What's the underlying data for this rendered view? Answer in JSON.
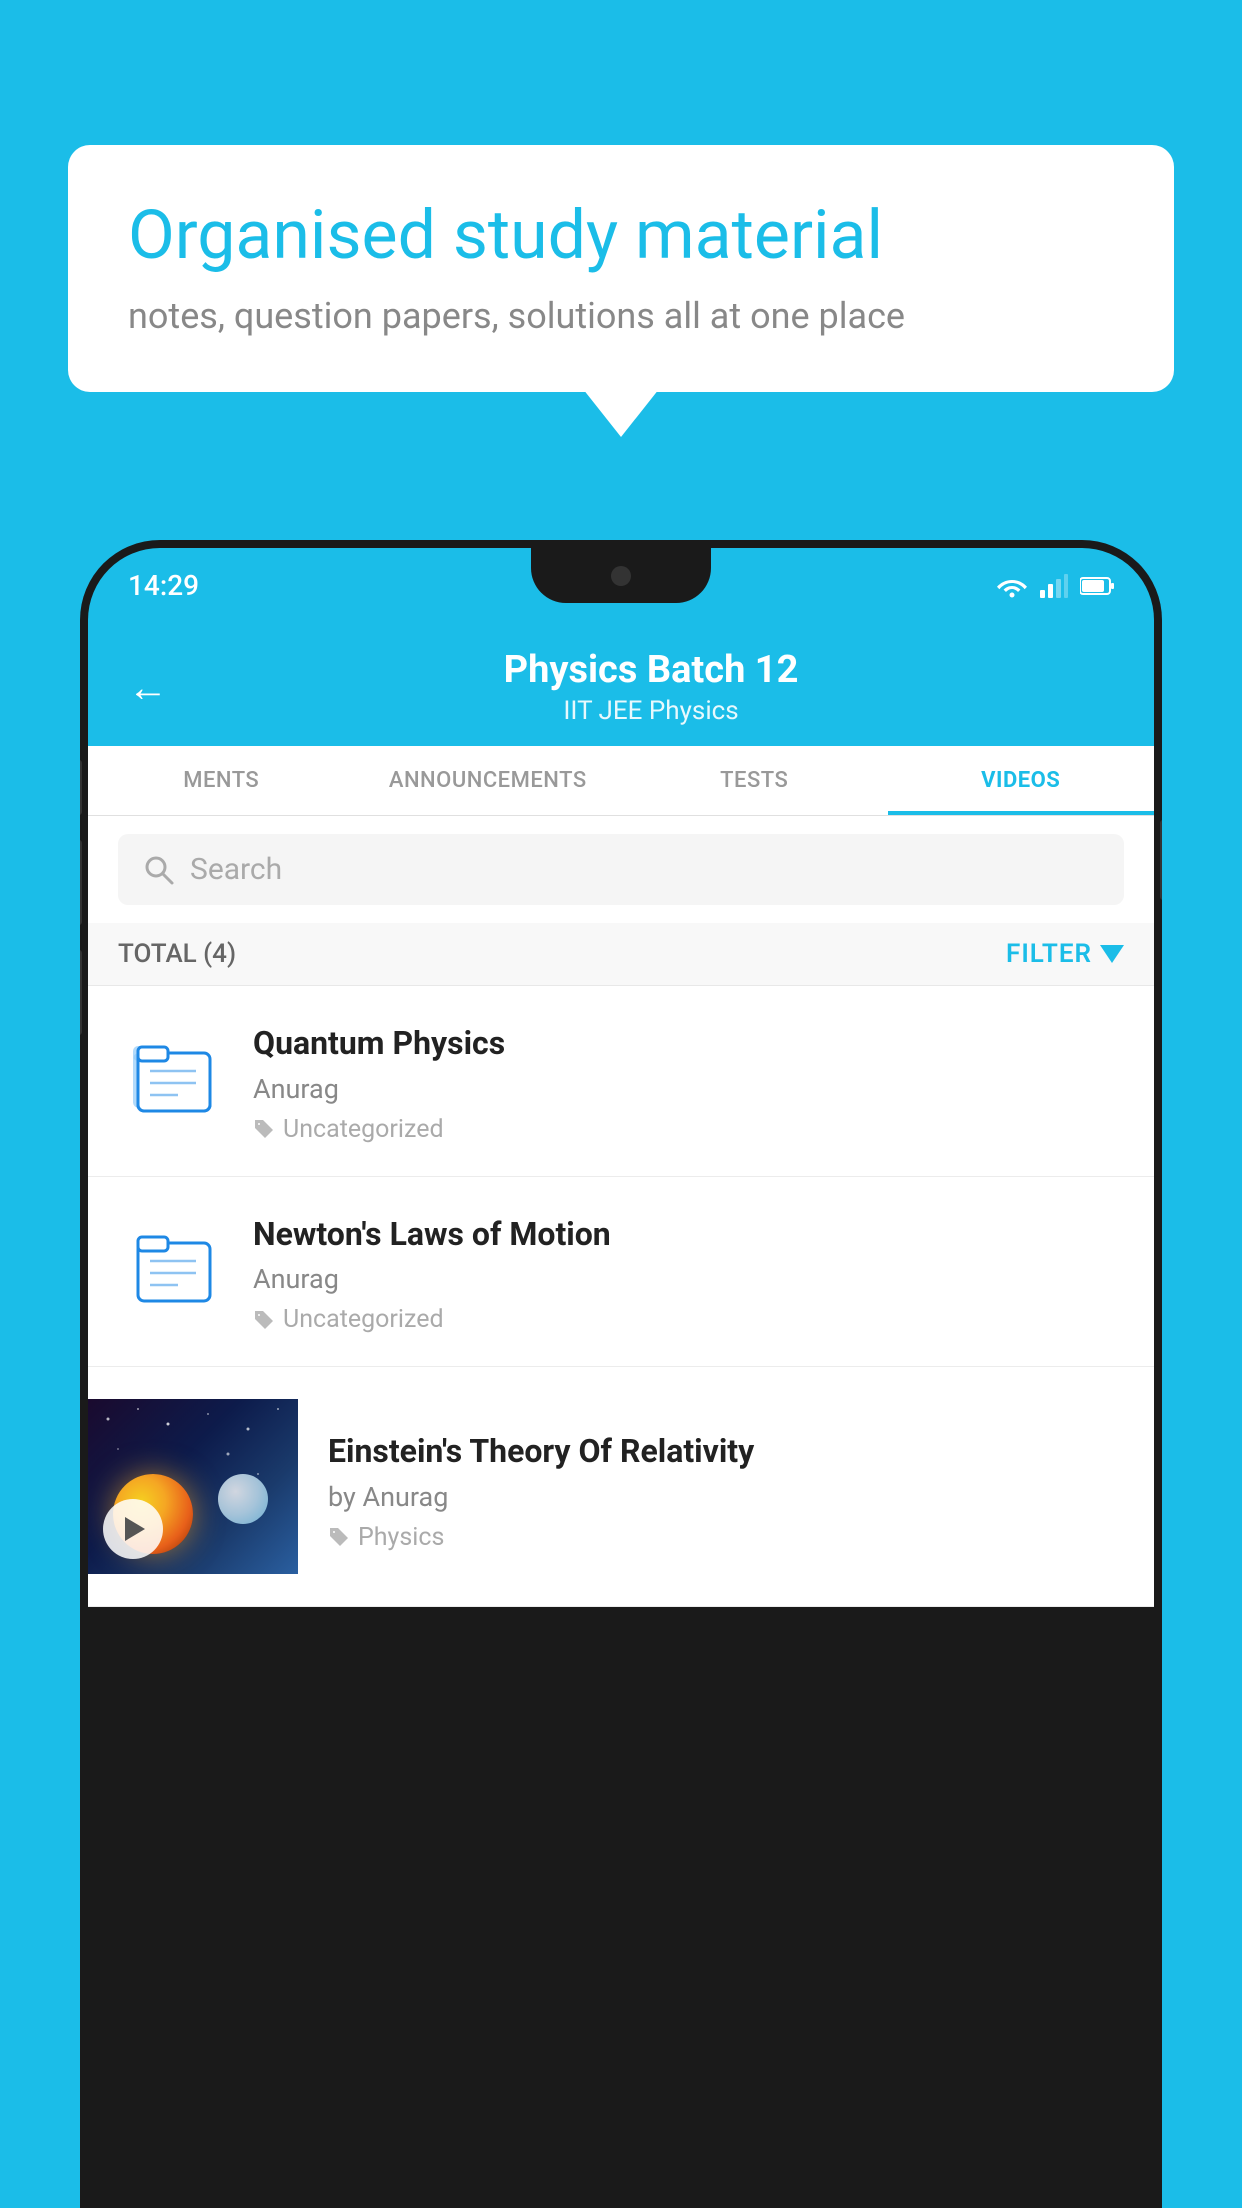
{
  "background_color": "#1bbde8",
  "bubble": {
    "title": "Organised study material",
    "subtitle": "notes, question papers, solutions all at one place"
  },
  "status_bar": {
    "time": "14:29",
    "icons": [
      "wifi",
      "signal",
      "battery"
    ]
  },
  "app_header": {
    "back_label": "←",
    "title": "Physics Batch 12",
    "subtitle": "IIT JEE   Physics"
  },
  "tabs": [
    {
      "label": "MENTS",
      "active": false
    },
    {
      "label": "ANNOUNCEMENTS",
      "active": false
    },
    {
      "label": "TESTS",
      "active": false
    },
    {
      "label": "VIDEOS",
      "active": true
    }
  ],
  "search": {
    "placeholder": "Search"
  },
  "filter_row": {
    "total_label": "TOTAL (4)",
    "filter_label": "FILTER"
  },
  "videos": [
    {
      "title": "Quantum Physics",
      "author": "Anurag",
      "tag": "Uncategorized",
      "type": "folder"
    },
    {
      "title": "Newton's Laws of Motion",
      "author": "Anurag",
      "tag": "Uncategorized",
      "type": "folder"
    },
    {
      "title": "Einstein's Theory Of Relativity",
      "author": "by Anurag",
      "tag": "Physics",
      "type": "video"
    }
  ]
}
